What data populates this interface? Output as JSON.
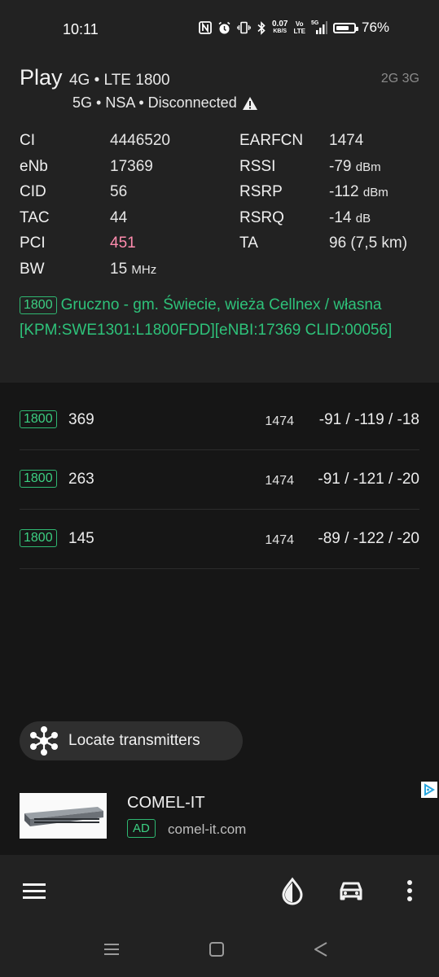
{
  "status_bar": {
    "time": "10:11",
    "data_speed_value": "0.07",
    "data_speed_unit": "KB/S",
    "volte_top": "Vo",
    "volte_bottom": "LTE",
    "network_badge": "5G",
    "battery_level": 0.76,
    "battery_percent": "76%",
    "icons": [
      "nfc-icon",
      "alarm-icon",
      "vibrate-icon",
      "bluetooth-icon",
      "signal-icon",
      "battery-icon"
    ]
  },
  "cell": {
    "operator": "Play",
    "technology": "4G • LTE 1800",
    "alt_technologies": "2G 3G",
    "nr_status": "5G • NSA • Disconnected",
    "params": [
      {
        "key": "CI",
        "value": "4446520",
        "unit": "",
        "key2": "EARFCN",
        "value2": "1474",
        "unit2": ""
      },
      {
        "key": "eNb",
        "value": "17369",
        "unit": "",
        "key2": "RSSI",
        "value2": "-79",
        "unit2": "dBm"
      },
      {
        "key": "CID",
        "value": "56",
        "unit": "",
        "key2": "RSRP",
        "value2": "-112",
        "unit2": "dBm"
      },
      {
        "key": "TAC",
        "value": "44",
        "unit": "",
        "key2": "RSRQ",
        "value2": "-14",
        "unit2": "dB"
      },
      {
        "key": "PCI",
        "value": "451",
        "unit": "",
        "key2": "TA",
        "value2": "96 (7,5 km)",
        "unit2": ""
      },
      {
        "key": "BW",
        "value": "15",
        "unit": "MHz",
        "key2": "",
        "value2": "",
        "unit2": ""
      }
    ],
    "band_badge": "1800",
    "site_info": "Gruczno - gm. Świecie, wieża Cellnex / własna [KPM:SWE1301:L1800FDD][eNBI:17369 CLID:00056]"
  },
  "neighbors": [
    {
      "band": "1800",
      "pci": "369",
      "earfcn": "1474",
      "signal": "-91 / -119 / -18"
    },
    {
      "band": "1800",
      "pci": "263",
      "earfcn": "1474",
      "signal": "-91 / -121 / -20"
    },
    {
      "band": "1800",
      "pci": "145",
      "earfcn": "1474",
      "signal": "-89 / -122 / -20"
    }
  ],
  "locate_button": {
    "label": "Locate transmitters"
  },
  "ad": {
    "title": "COMEL-IT",
    "badge": "AD",
    "url": "comel-it.com"
  },
  "colors": {
    "accent_green": "#2ec27a",
    "pci_highlight": "#ff8cae",
    "background": "#161616",
    "panel": "#222222"
  }
}
